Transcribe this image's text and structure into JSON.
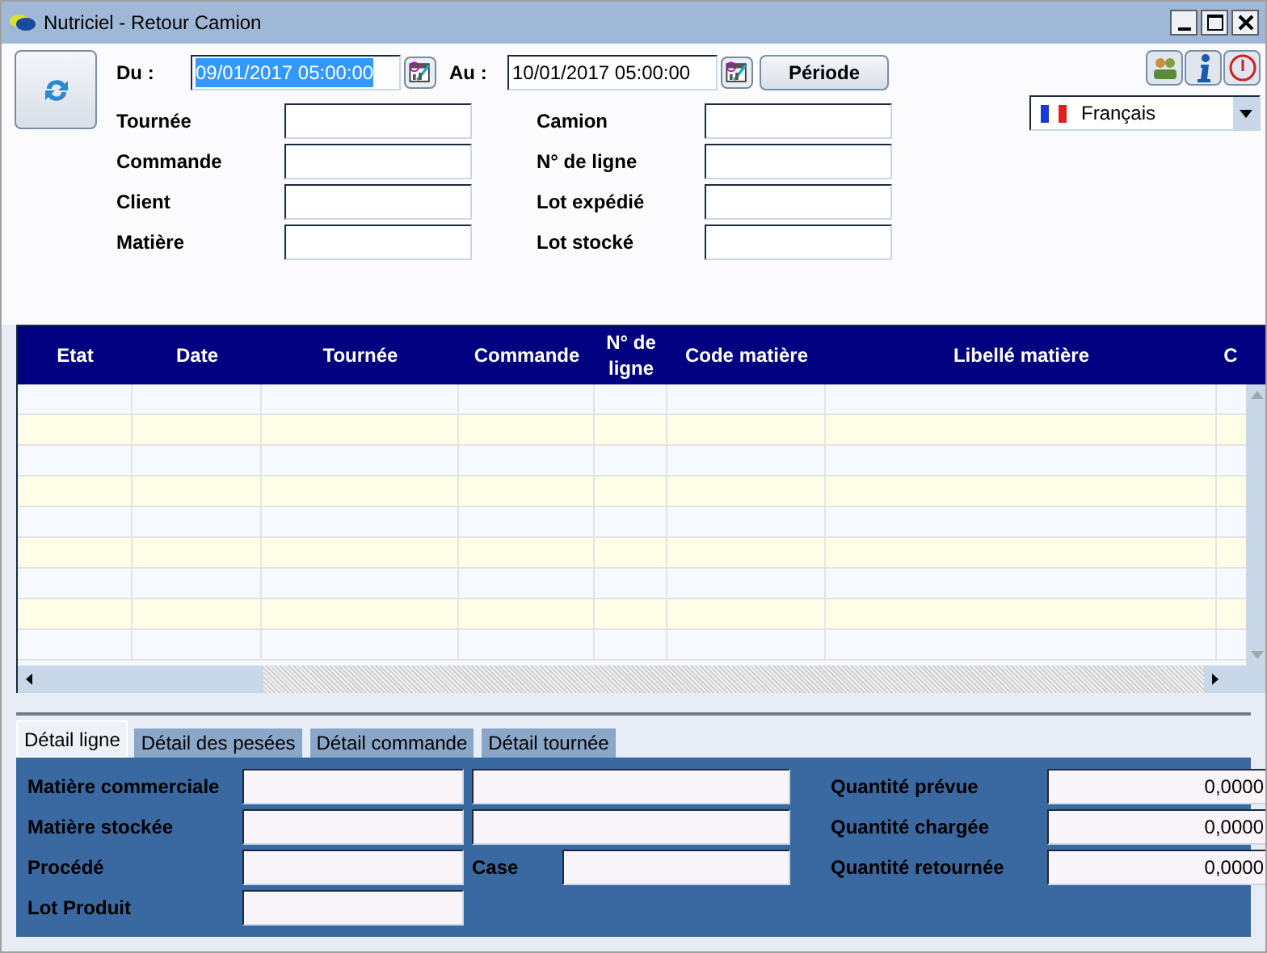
{
  "window": {
    "title": "Nutriciel - Retour Camion"
  },
  "dates": [
    {
      "label": "Du :",
      "value": "09/01/2017 05:00:00",
      "text_selected": true
    },
    {
      "label": "Au :",
      "value": "10/01/2017 05:00:00",
      "text_selected": false
    }
  ],
  "period_button": "Période",
  "language": "Français",
  "filters_left": [
    {
      "label": "Tournée"
    },
    {
      "label": "Commande"
    },
    {
      "label": "Client"
    },
    {
      "label": "Matière"
    }
  ],
  "filters_right": [
    {
      "label": "Camion"
    },
    {
      "label": "N° de ligne"
    },
    {
      "label": "Lot expédié"
    },
    {
      "label": "Lot stocké"
    }
  ],
  "table": {
    "columns": [
      "Etat",
      "Date",
      "Tournée",
      "Commande",
      "N° de ligne",
      "Code matière",
      "Libellé matière",
      "C"
    ]
  },
  "tabs": [
    {
      "label": "Détail ligne",
      "selected": true
    },
    {
      "label": "Détail des pesées",
      "selected": false
    },
    {
      "label": "Détail commande",
      "selected": false
    },
    {
      "label": "Détail tournée",
      "selected": false
    }
  ],
  "detail_left": [
    {
      "label": "Matière commerciale",
      "kind": "double"
    },
    {
      "label": "Matière stockée",
      "kind": "double"
    },
    {
      "label": "Procédé",
      "kind": "case",
      "extra_label": "Case"
    },
    {
      "label": "Lot Produit",
      "kind": "single"
    }
  ],
  "detail_right": [
    {
      "label": "Quantité prévue",
      "value": "0,0000"
    },
    {
      "label": "Quantité chargée",
      "value": "0,0000"
    },
    {
      "label": "Quantité retournée",
      "value": "0,0000"
    }
  ]
}
